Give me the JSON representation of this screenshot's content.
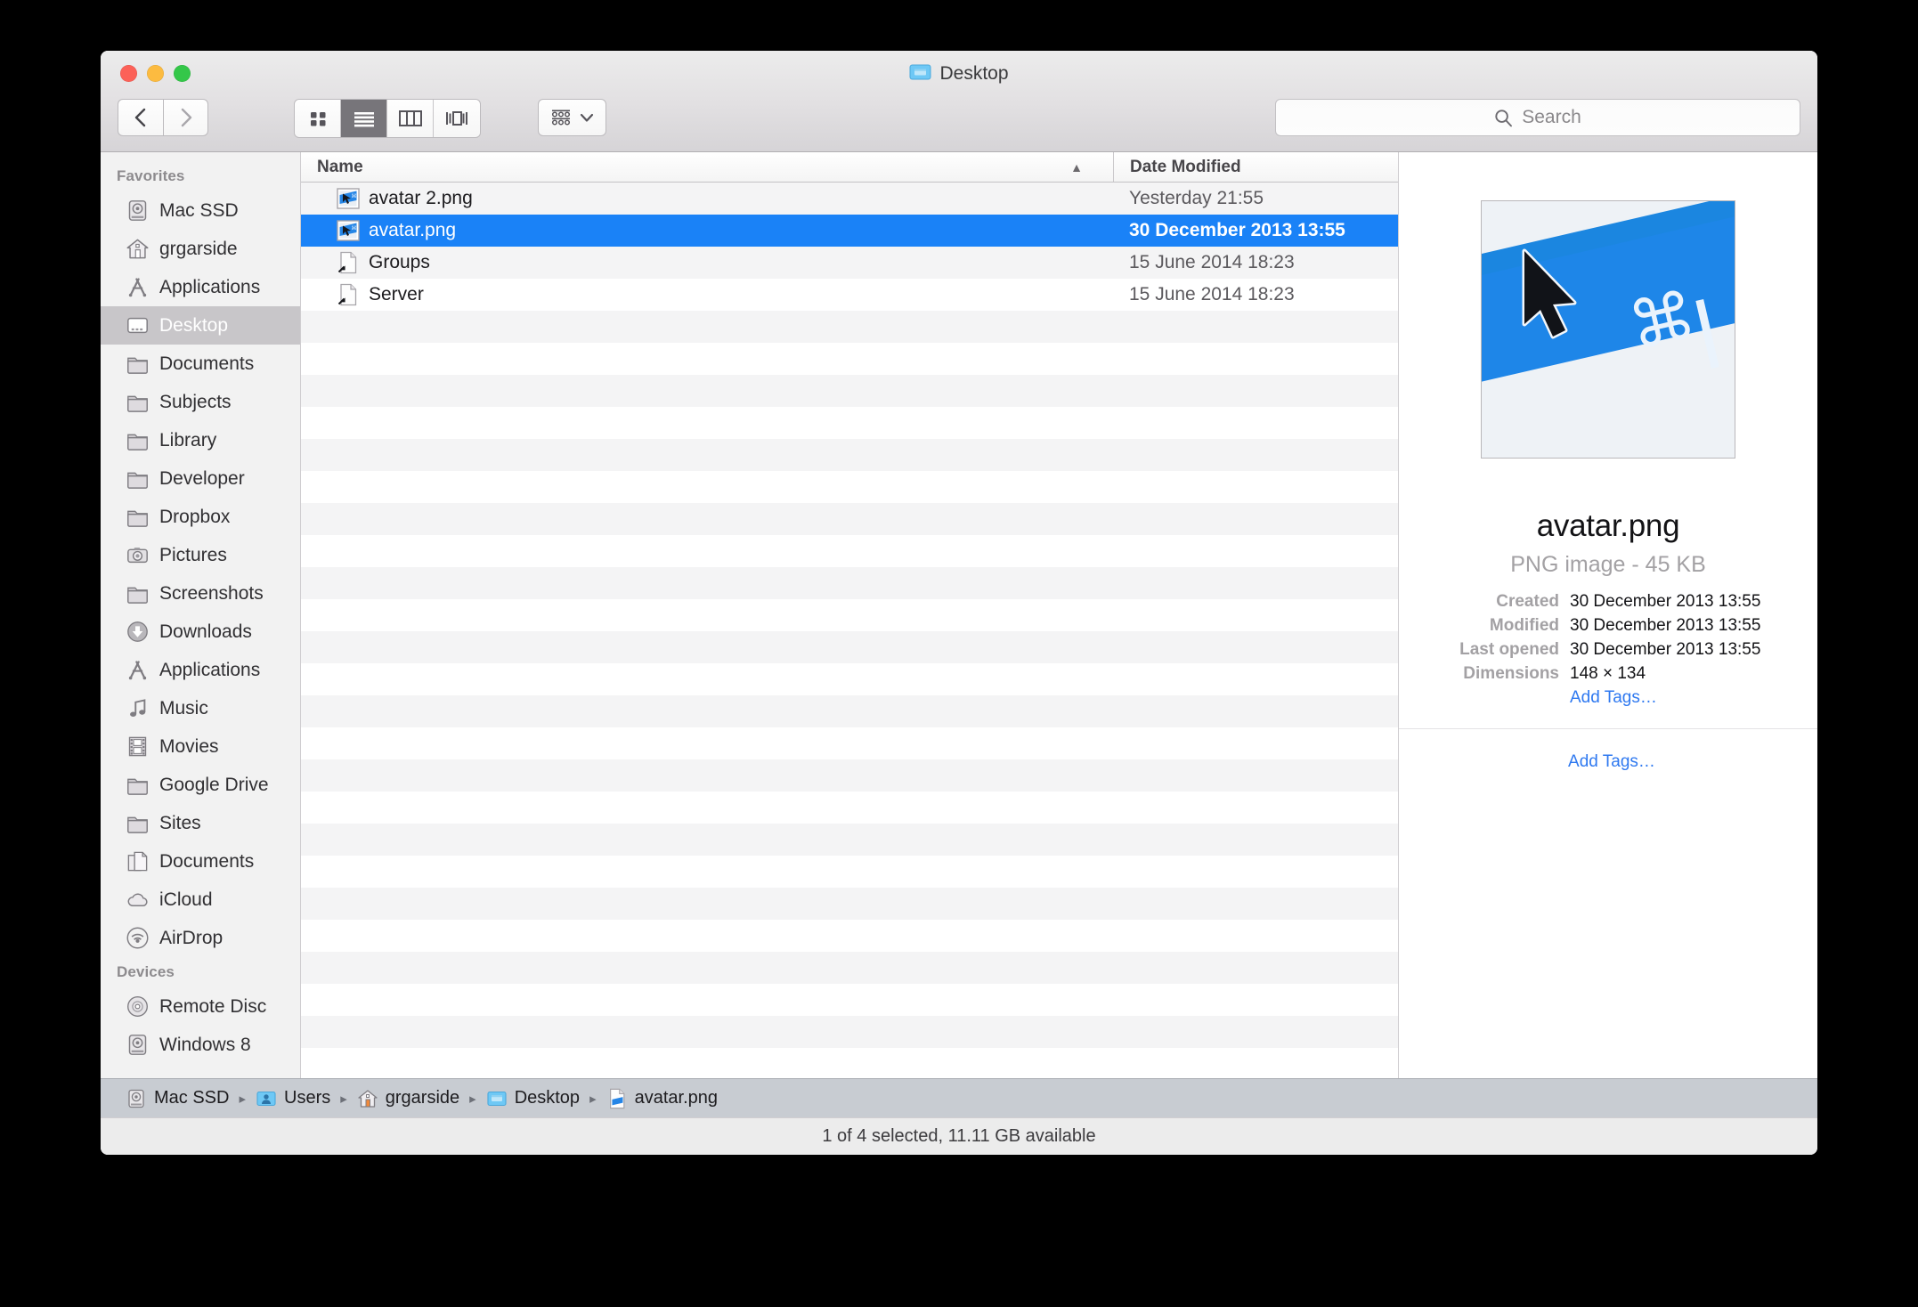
{
  "window": {
    "title": "Desktop",
    "title_icon": "folder-icon",
    "traffic_lights": [
      "close-button",
      "minimize-button",
      "zoom-button"
    ]
  },
  "toolbar": {
    "back_label": "Back",
    "forward_label": "Forward",
    "view_modes": [
      {
        "name": "icon-view",
        "label": "Icon view",
        "active": false
      },
      {
        "name": "list-view",
        "label": "List view",
        "active": true
      },
      {
        "name": "column-view",
        "label": "Column view",
        "active": false
      },
      {
        "name": "coverflow-view",
        "label": "Cover Flow view",
        "active": false
      }
    ],
    "arrange_label": "Arrange",
    "search_placeholder": "Search",
    "search_value": ""
  },
  "sidebar": {
    "sections": [
      {
        "header": "Favorites",
        "items": [
          {
            "label": "Mac SSD",
            "icon": "hard-drive-icon",
            "selected": false
          },
          {
            "label": "grgarside",
            "icon": "home-icon",
            "selected": false
          },
          {
            "label": "Applications",
            "icon": "applications-icon",
            "selected": false
          },
          {
            "label": "Desktop",
            "icon": "desktop-icon",
            "selected": true
          },
          {
            "label": "Documents",
            "icon": "folder-icon",
            "selected": false
          },
          {
            "label": "Subjects",
            "icon": "folder-icon",
            "selected": false
          },
          {
            "label": "Library",
            "icon": "folder-icon",
            "selected": false
          },
          {
            "label": "Developer",
            "icon": "folder-icon",
            "selected": false
          },
          {
            "label": "Dropbox",
            "icon": "folder-icon",
            "selected": false
          },
          {
            "label": "Pictures",
            "icon": "camera-icon",
            "selected": false
          },
          {
            "label": "Screenshots",
            "icon": "folder-icon",
            "selected": false
          },
          {
            "label": "Downloads",
            "icon": "download-icon",
            "selected": false
          },
          {
            "label": "Applications",
            "icon": "applications-icon",
            "selected": false
          },
          {
            "label": "Music",
            "icon": "music-note-icon",
            "selected": false
          },
          {
            "label": "Movies",
            "icon": "film-icon",
            "selected": false
          },
          {
            "label": "Google Drive",
            "icon": "folder-icon",
            "selected": false
          },
          {
            "label": "Sites",
            "icon": "folder-icon",
            "selected": false
          },
          {
            "label": "Documents",
            "icon": "documents-icon",
            "selected": false
          },
          {
            "label": "iCloud",
            "icon": "cloud-icon",
            "selected": false
          },
          {
            "label": "AirDrop",
            "icon": "airdrop-icon",
            "selected": false
          }
        ]
      },
      {
        "header": "Devices",
        "items": [
          {
            "label": "Remote Disc",
            "icon": "optical-disc-icon",
            "selected": false
          },
          {
            "label": "Windows 8",
            "icon": "hard-drive-icon",
            "selected": false
          }
        ]
      }
    ]
  },
  "file_list": {
    "columns": [
      {
        "label": "Name",
        "sorted": true,
        "sort_direction": "ascending"
      },
      {
        "label": "Date Modified",
        "sorted": false
      }
    ],
    "rows": [
      {
        "name": "avatar 2.png",
        "date": "Yesterday 21:55",
        "icon": "png-thumbnail-icon",
        "selected": false
      },
      {
        "name": "avatar.png",
        "date": "30 December 2013 13:55",
        "icon": "png-thumbnail-icon",
        "selected": true
      },
      {
        "name": "Groups",
        "date": "15 June 2014 18:23",
        "icon": "alias-document-icon",
        "selected": false
      },
      {
        "name": "Server",
        "date": "15 June 2014 18:23",
        "icon": "alias-document-icon",
        "selected": false
      }
    ],
    "empty_row_count": 24
  },
  "preview": {
    "thumbnail_name": "avatar-png-preview",
    "filename": "avatar.png",
    "kind_and_size": "PNG image - 45 KB",
    "metadata": [
      {
        "label": "Created",
        "value": "30 December 2013 13:55"
      },
      {
        "label": "Modified",
        "value": "30 December 2013 13:55"
      },
      {
        "label": "Last opened",
        "value": "30 December 2013 13:55"
      },
      {
        "label": "Dimensions",
        "value": "148 × 134"
      }
    ],
    "add_tags_label": "Add Tags…",
    "add_tags_label_2": "Add Tags…"
  },
  "path_bar": {
    "crumbs": [
      {
        "label": "Mac SSD",
        "icon": "hard-drive-icon"
      },
      {
        "label": "Users",
        "icon": "users-folder-icon"
      },
      {
        "label": "grgarside",
        "icon": "home-folder-icon"
      },
      {
        "label": "Desktop",
        "icon": "desktop-folder-icon"
      },
      {
        "label": "avatar.png",
        "icon": "png-document-icon"
      }
    ],
    "separator": "▸"
  },
  "status_bar": {
    "text": "1 of 4 selected, 11.11 GB available"
  },
  "colors": {
    "selection_blue": "#1a82f7",
    "link_blue": "#2f79f0",
    "sidebar_bg": "#f2f2f2",
    "pathbar_bg": "#c8ccd2",
    "stripe": "#f4f4f5"
  }
}
